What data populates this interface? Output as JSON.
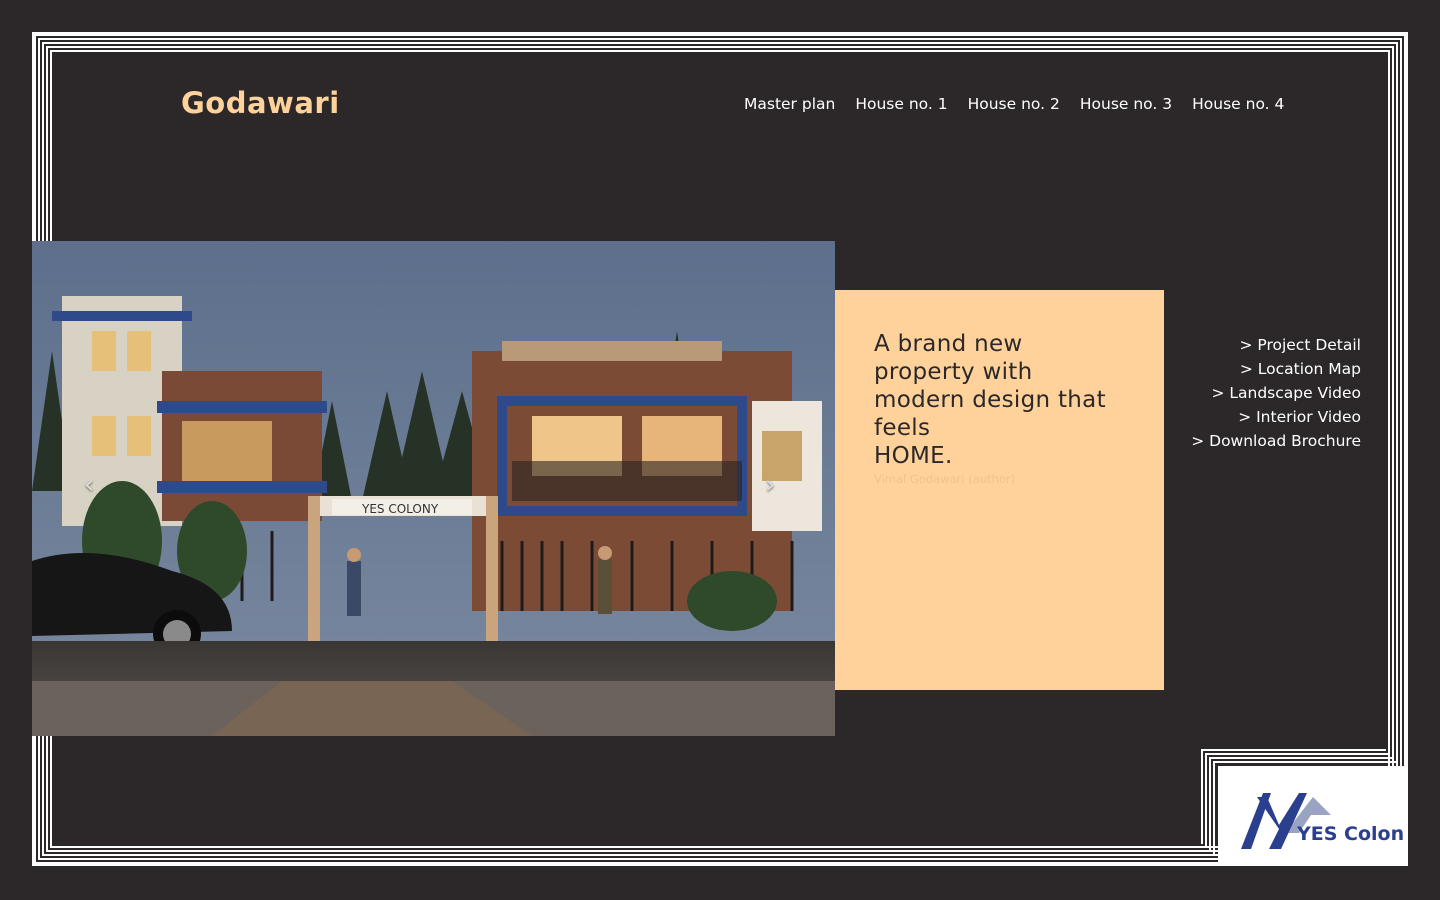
{
  "brand": {
    "name": "Godawari"
  },
  "nav": {
    "items": [
      "Master plan",
      "House no. 1",
      "House no. 2",
      "House no. 3",
      "House no. 4"
    ]
  },
  "carousel": {
    "prev_label": "‹",
    "next_label": "›",
    "sign_text": "YES COLONY"
  },
  "card": {
    "tagline_line1": "A brand new property with modern design that feels",
    "tagline_line2": "HOME.",
    "author": "Vimal Godawari (author)"
  },
  "side_links": [
    "> Project Detail",
    "> Location Map",
    "> Landscape Video",
    "> Interior Video",
    "> Download Brochure"
  ],
  "logo": {
    "text": "YES Colony"
  },
  "colors": {
    "background": "#2c2829",
    "accent": "#ffd29b",
    "logo_blue": "#2b3f8f"
  }
}
